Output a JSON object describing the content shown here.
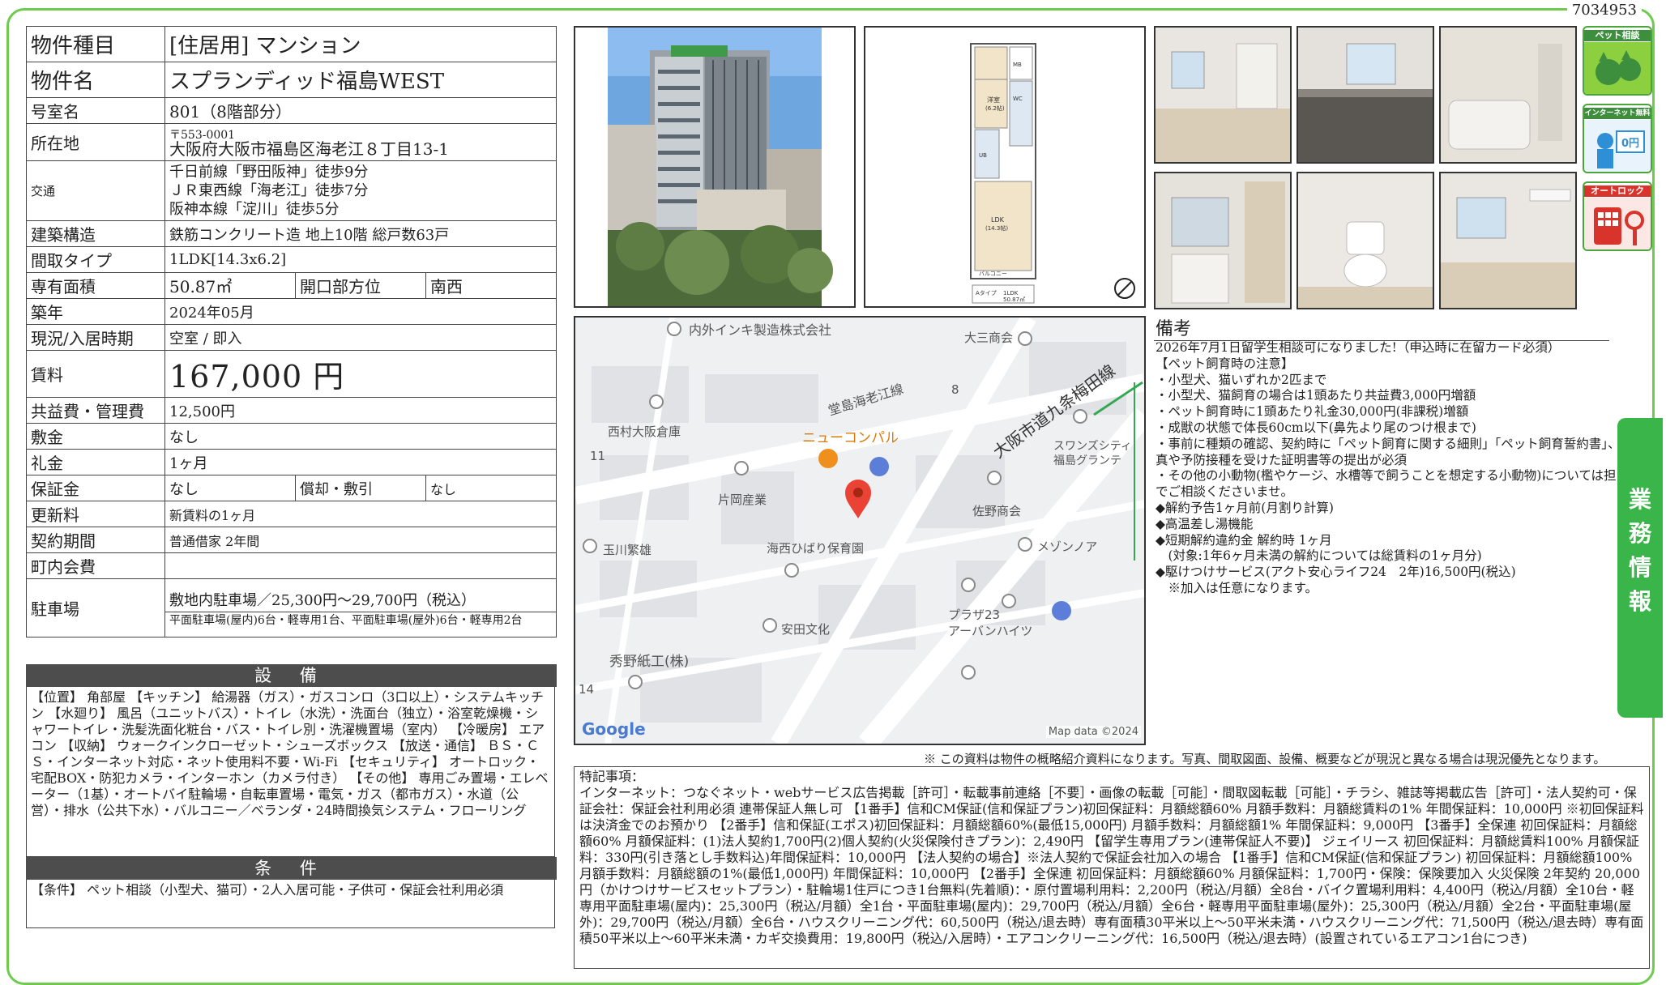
{
  "doc_id": "7034953",
  "property": {
    "type_label": "物件種目",
    "type_value": "[住居用] マンション",
    "name_label": "物件名",
    "name_value": "スプランディッド福島WEST",
    "room_label": "号室名",
    "room_value": "801（8階部分）",
    "address_label": "所在地",
    "postal": "〒553-0001",
    "address": "大阪府大阪市福島区海老江８丁目13-1",
    "transport_label": "交通",
    "transport": [
      "千日前線「野田阪神」徒歩9分",
      "ＪＲ東西線「海老江」徒歩7分",
      "阪神本線「淀川」徒歩5分"
    ],
    "structure_label": "建築構造",
    "structure": "鉄筋コンクリート造 地上10階 総戸数63戸",
    "layout_label": "間取タイプ",
    "layout": "1LDK[14.3x6.2]",
    "area_label": "専有面積",
    "area": "50.87㎡",
    "direction_label": "開口部方位",
    "direction": "南西",
    "built_label": "築年",
    "built": "2024年05月",
    "status_label": "現況/入居時期",
    "status": "空室 / 即入",
    "rent_label": "賃料",
    "rent": "167,000 円",
    "fee_label": "共益費・管理費",
    "fee": "12,500円",
    "deposit_label": "敷金",
    "deposit": "なし",
    "key_money_label": "礼金",
    "key_money": "1ヶ月",
    "guarantee_label": "保証金",
    "guarantee": "なし",
    "amort_label": "償却・敷引",
    "amort": "なし",
    "renewal_label": "更新料",
    "renewal": "新賃料の1ヶ月",
    "contract_label": "契約期間",
    "contract": "普通借家 2年間",
    "town_label": "町内会費",
    "town": "",
    "parking_label": "駐車場",
    "parking": "敷地内駐車場／25,300円〜29,700円（税込）",
    "parking_detail": "平面駐車場(屋内)6台・軽専用1台、平面駐車場(屋外)6台・軽専用2台"
  },
  "equipment_header": "設 備",
  "equipment": "【位置】 角部屋 【キッチン】 給湯器（ガス）・ガスコンロ（3口以上）・システムキッチン 【水廻り】 風呂（ユニットバス）・トイレ（水洗）・洗面台（独立）・浴室乾燥機・シャワートイレ・洗髪洗面化粧台・バス・トイレ別・洗濯機置場（室内） 【冷暖房】 エアコン 【収納】 ウォークインクローゼット・シューズボックス 【放送・通信】 ＢＳ・ＣＳ・インターネット対応・ネット使用料不要・Wi-Fi 【セキュリティ】 オートロック・宅配BOX・防犯カメラ・インターホン（カメラ付き） 【その他】 専用ごみ置場・エレベーター（1基）・オートバイ駐輪場・自転車置場・電気・ガス（都市ガス）・水道（公営）・排水（公共下水）・バルコニー／ベランダ・24時間換気システム・フローリング",
  "conditions_header": "条 件",
  "conditions": "【条件】 ペット相談（小型犬、猫可）・2人入居可能・子供可・保証会社利用必須",
  "icons": [
    {
      "name": "pet-consult-icon",
      "label": "ペット相談"
    },
    {
      "name": "internet-free-icon",
      "label": "インターネット無料"
    },
    {
      "name": "auto-lock-icon",
      "label": "オートロック"
    }
  ],
  "map": {
    "labels": [
      "内外インキ製造株式会社",
      "大三商会",
      "堂島海老江線",
      "大阪市道九条梅田線",
      "西村大阪倉庫",
      "ニューコンパル",
      "スワンズシティ",
      "福島グランテ",
      "片岡産業",
      "佐野商会",
      "玉川繁雄",
      "海西ひばり保育園",
      "メゾンノア",
      "安田文化",
      "プラザ23",
      "アーバンハイツ",
      "秀野紙工(株)"
    ],
    "numbers": [
      "8",
      "11",
      "14"
    ],
    "google": "Google",
    "attribution": "Map data ©2024"
  },
  "remarks_header": "備考",
  "remarks": "2026年7月1日留学生相談可になりました!（申込時に在留カード必須）\n【ペット飼育時の注意】\n・小型犬、猫いずれか2匹まで\n・小型犬、猫飼育の場合は1頭あたり共益費3,000円増額\n・ペット飼育時に1頭あたり礼金30,000円(非課税)増額\n・成獣の状態で体長60cm以下(鼻先より尾のつけ根まで)\n・事前に種類の確認、契約時に「ペット飼育に関する細則」「ペット飼育誓約書」、写真や予防接種を受けた証明書等の提出が必須\n・その他の小動物(檻やケージ、水槽等で飼うことを想定する小動物)については担当までご相談くださいませ。\n◆解約予告1ヶ月前(月割り計算)\n◆高温差し湯機能\n◆短期解約違約金 解約時 1ヶ月\n　(対象:1年6ヶ月未満の解約については総賃料の1ヶ月分)\n◆駆けつけサービス(アクト安心ライフ24　2年)16,500円(税込)\n　※加入は任意になります。",
  "notice": "※ この資料は物件の概略紹介資料になります。写真、間取図面、設備、概要などが現況と異なる場合は現況優先となります。",
  "special_notes": "特記事項：\nインターネット：つなぐネット・webサービス広告掲載［許可］・転載事前連絡［不要］・画像の転載［可能］・間取図転載［可能］・チラシ、雑誌等掲載広告［許可］・法人契約可・保証会社：保証会社利用必須 連帯保証人無し可 【1番手】信和CM保証(信和保証プラン)初回保証料：月額総額60% 月額手数料：月額総賃料の1% 年間保証料：10,000円 ※初回保証料は決済金でのお預かり 【2番手】信和保証(エポス)初回保証料：月額総額60%(最低15,000円) 月額手数料：月額総額1% 年間保証料：9,000円 【3番手】全保連 初回保証料：月額総額60% 月額保証料：(1)法人契約1,700円(2)個人契約(火災保険付きプラン)：2,490円 【留学生専用プラン(連帯保証人不要)】 ジェイリース 初回保証料：月額総賃料100% 月額保証料：330円(引き落とし手数料込)年間保証料：10,000円 【法人契約の場合】※法人契約で保証会社加入の場合 【1番手】信和CM保証(信和保証プラン) 初回保証料：月額総額100% 月額手数料：月額総額の1%(最低1,000円) 年間保証料：10,000円 【2番手】全保連 初回保証料：月額総額60% 月額保証料：1,700円・保険：保険要加入 火災保険 2年契約 20,000円（かけつけサービスセットプラン）・駐輪場1住戸につき1台無料(先着順)：・原付置場利用料：2,200円（税込/月額）全8台・バイク置場利用料：4,400円（税込/月額）全10台・軽専用平面駐車場(屋内)：25,300円（税込/月額）全1台・平面駐車場(屋内)：29,700円（税込/月額）全6台・軽専用平面駐車場(屋外)：25,300円（税込/月額）全2台・平面駐車場(屋外)：29,700円（税込/月額）全6台・ハウスクリーニング代：60,500円（税込/退去時）専有面積30平米以上〜50平米未満・ハウスクリーニング代：71,500円（税込/退去時）専有面積50平米以上〜60平米未満・カギ交換費用：19,800円（税込/入居時）・エアコンクリーニング代：16,500円（税込/退去時）(設置されているエアコン1台につき)",
  "side_tab": "業務情報",
  "floorplan": {
    "unit_label": "1LDK",
    "area_label": "50.87㎡",
    "labels": [
      "サービスバルコニー",
      "洋室(6.2帖)",
      "MB",
      "WC",
      "廊下",
      "UB",
      "CL",
      "LDK(14.3帖)",
      "バルコニー",
      "Aタイプ"
    ]
  }
}
